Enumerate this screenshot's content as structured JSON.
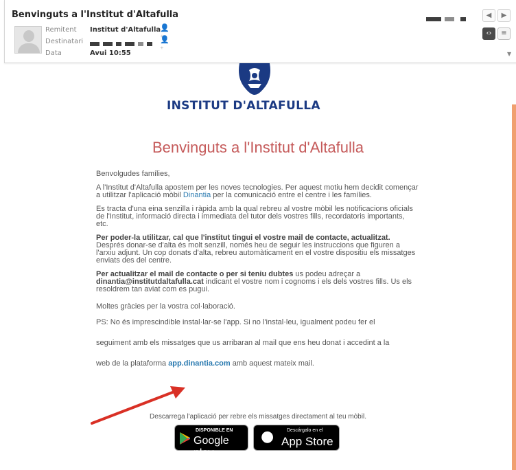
{
  "header": {
    "subject": "Benvinguts a l'Institut d'Altafulla",
    "sender_label": "Remitent",
    "sender": "Institut d'Altafulla",
    "recipients_label": "Destinatari",
    "date_label": "Data",
    "date": "Avui 10:55"
  },
  "icons": {
    "prev": "chevron-left-icon",
    "next": "chevron-right-icon",
    "source": "code-icon",
    "menu": "menu-icon",
    "add_contact": "add-contact-icon"
  },
  "email": {
    "logo_text": "INSTITUT D'ALTAFULLA",
    "title": "Benvinguts a l'Institut d'Altafulla",
    "greeting": "Benvolgudes famílies,",
    "p1_a": "A l'Institut d'Altafulla apostem per les noves tecnologies. Per aquest motiu hem decidit començar a utilitzar l'aplicació mòbil",
    "p1_link": "Dinantia",
    "p1_b": "per la comunicació entre el centre i les famílies.",
    "p2": "Es tracta d'una eina senzilla i ràpida amb la qual rebreu al vostre mòbil les notificacions oficials de l'Institut, informació directa i immediata del tutor dels vostres fills, recordatoris importants, etc.",
    "p3_bold": "Per poder-la utilitzar, cal que l'institut tingui el vostre mail de contacte, actualitzat.",
    "p3": "Després donar-se d'alta és molt senzill, només heu de seguir les instruccions que figuren a l'arxiu adjunt. Un cop donats d'alta, rebreu automàticament en el vostre dispositiu els missatges enviats des del centre.",
    "p4_bold": "Per actualitzar el mail de contacte o per si teniu dubtes",
    "p4_a": "us podeu adreçar a",
    "p4_email": "dinantia@institutdaltafulla.cat",
    "p4_b": "indicant el vostre nom i cognoms i els dels vostres fills. Us els resoldrem tan aviat com es pugui.",
    "thanks": "Moltes gràcies per la vostra col·laboració.",
    "ps1": "PS: No és imprescindible instal·lar-se l'app. Si no l'instal·leu, igualment podeu fer el",
    "ps2": "seguiment amb els missatges que us arribaran al mail que ens heu donat i accedint a la",
    "ps3_a": "web de la plataforma",
    "ps3_link": "app.dinantia.com",
    "ps3_b": "amb aquest mateix mail.",
    "download": "Descarrega l'aplicació per rebre els missatges directament al teu mòbil.",
    "gplay_small": "DISPONIBLE EN",
    "gplay_big": "Google play",
    "appstore_small": "Descárgalo en el",
    "appstore_big": "App Store"
  },
  "colors": {
    "title": "#c55a5a",
    "logo": "#1b3a83",
    "link": "#2a7ab0",
    "arrow": "#d93025"
  }
}
